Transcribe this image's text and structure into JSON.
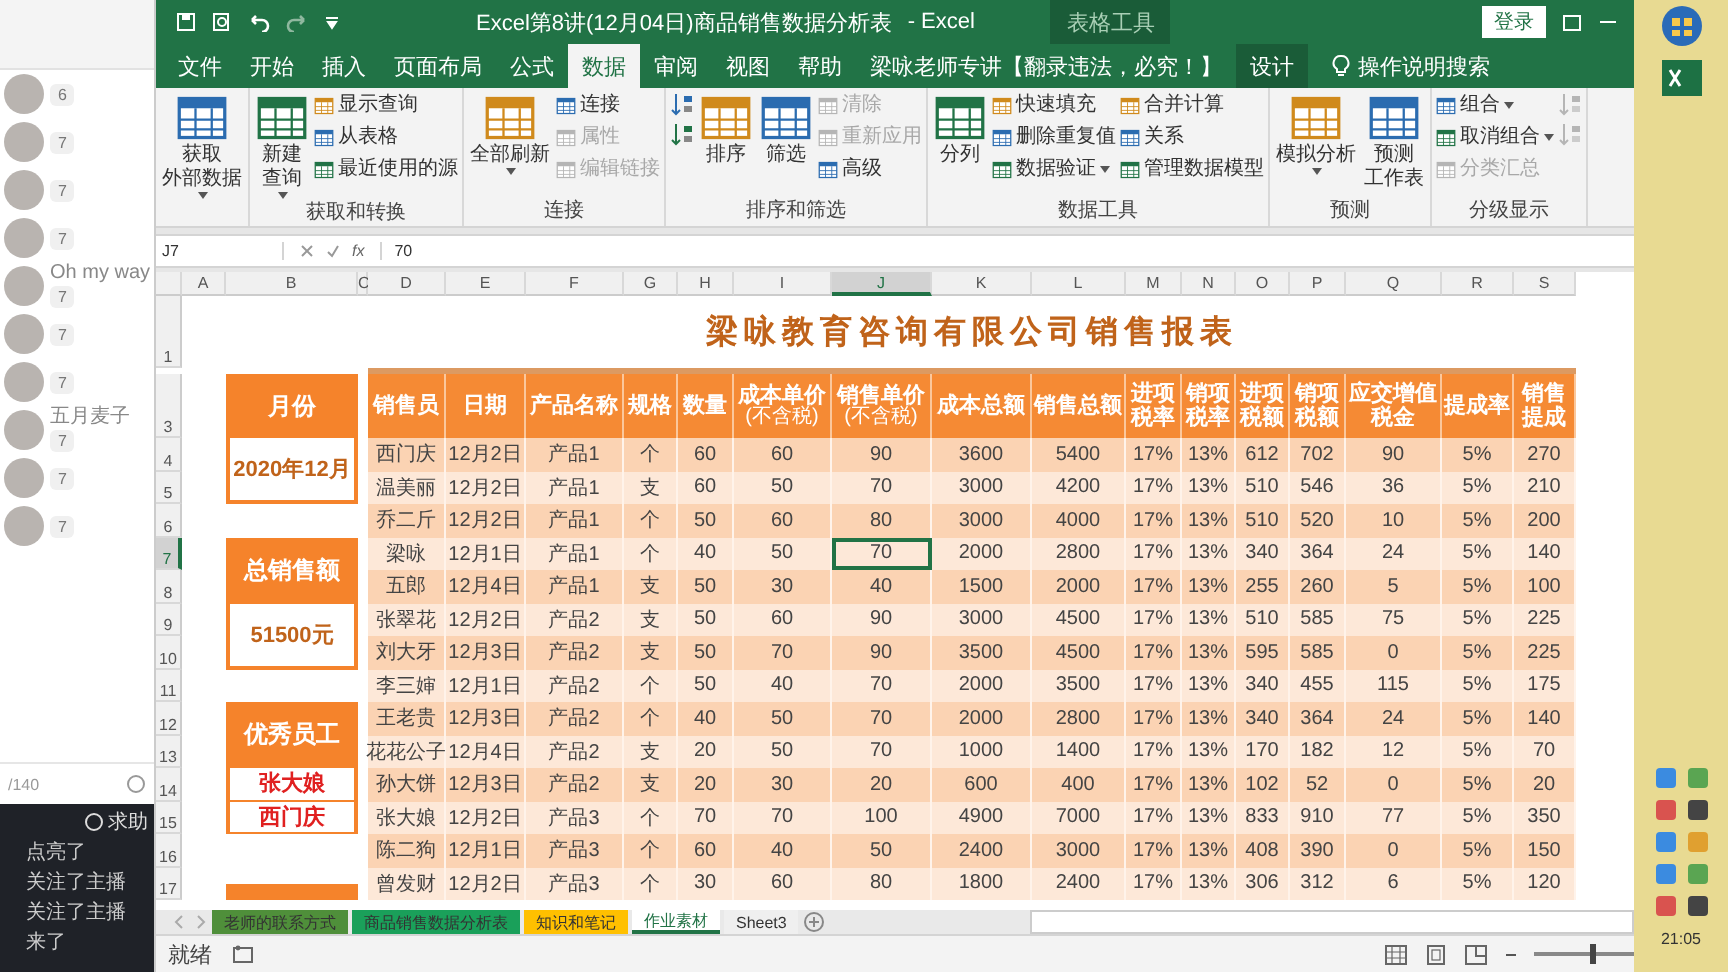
{
  "chat_panel": {
    "members": [
      {
        "count": "6"
      },
      {
        "count": "7"
      },
      {
        "count": "7"
      },
      {
        "count": "7"
      },
      {
        "name": "Oh my way",
        "count": "7"
      },
      {
        "count": "7"
      },
      {
        "count": "7"
      },
      {
        "name": "五月麦子",
        "count": "7"
      },
      {
        "count": "7"
      },
      {
        "count": "7"
      }
    ],
    "char_counter": "/140",
    "help_button": "求助",
    "messages": [
      "点亮了",
      "关注了主播",
      "关注了主播",
      "来了"
    ]
  },
  "window": {
    "title": "Excel第8讲(12月04日)商品销售数据分析表",
    "app": "- Excel",
    "context_label": "表格工具",
    "login": "登录"
  },
  "tabs": [
    {
      "label": "文件",
      "selected": false
    },
    {
      "label": "开始",
      "selected": false
    },
    {
      "label": "插入",
      "selected": false
    },
    {
      "label": "页面布局",
      "selected": false
    },
    {
      "label": "公式",
      "selected": false
    },
    {
      "label": "数据",
      "selected": true
    },
    {
      "label": "审阅",
      "selected": false
    },
    {
      "label": "视图",
      "selected": false
    },
    {
      "label": "帮助",
      "selected": false
    },
    {
      "label": "梁咏老师专讲【翻录违法，必究！】",
      "selected": false
    },
    {
      "label": "设计",
      "selected": false
    }
  ],
  "tell_me": "操作说明搜索",
  "ribbon": [
    {
      "items": [
        {
          "kind": "large",
          "label": [
            "获取",
            "外部数据"
          ],
          "dropdown": true,
          "disabled": false
        }
      ]
    },
    {
      "label": "获取和转换",
      "items": [
        {
          "kind": "large",
          "label": [
            "新建",
            "查询"
          ],
          "dropdown": true,
          "disabled": false
        },
        {
          "kind": "small",
          "label": "显示查询",
          "dropdown": false,
          "disabled": false
        },
        {
          "kind": "small",
          "label": "从表格",
          "dropdown": false,
          "disabled": false
        },
        {
          "kind": "small",
          "label": "最近使用的源",
          "dropdown": false,
          "disabled": false
        }
      ]
    },
    {
      "label": "连接",
      "items": [
        {
          "kind": "large",
          "label": [
            "全部刷新"
          ],
          "dropdown": true,
          "disabled": false
        },
        {
          "kind": "small",
          "label": "连接",
          "dropdown": false,
          "disabled": false
        },
        {
          "kind": "small",
          "label": "属性",
          "dropdown": false,
          "disabled": true
        },
        {
          "kind": "small",
          "label": "编辑链接",
          "dropdown": false,
          "disabled": true
        }
      ]
    },
    {
      "label": "排序和筛选",
      "items": [
        {
          "kind": "icon",
          "disabled": false
        },
        {
          "kind": "icon",
          "disabled": false
        },
        {
          "kind": "large",
          "label": [
            "排序"
          ],
          "dropdown": false,
          "disabled": false
        },
        {
          "kind": "large",
          "label": [
            "筛选"
          ],
          "dropdown": false,
          "disabled": false
        },
        {
          "kind": "small",
          "label": "清除",
          "dropdown": false,
          "disabled": true
        },
        {
          "kind": "small",
          "label": "重新应用",
          "dropdown": false,
          "disabled": true
        },
        {
          "kind": "small",
          "label": "高级",
          "dropdown": false,
          "disabled": false
        }
      ]
    },
    {
      "label": "数据工具",
      "items": [
        {
          "kind": "large",
          "label": [
            "分列"
          ],
          "dropdown": false,
          "disabled": false
        },
        {
          "kind": "small",
          "label": "快速填充",
          "dropdown": false,
          "disabled": false
        },
        {
          "kind": "small",
          "label": "删除重复值",
          "dropdown": false,
          "disabled": false
        },
        {
          "kind": "small",
          "label": "数据验证",
          "dropdown": true,
          "disabled": false
        },
        {
          "kind": "small",
          "label": "合并计算",
          "dropdown": false,
          "disabled": false
        },
        {
          "kind": "small",
          "label": "关系",
          "dropdown": false,
          "disabled": false
        },
        {
          "kind": "small",
          "label": "管理数据模型",
          "dropdown": false,
          "disabled": false
        }
      ]
    },
    {
      "label": "预测",
      "items": [
        {
          "kind": "large",
          "label": [
            "模拟分析"
          ],
          "dropdown": true,
          "disabled": false
        },
        {
          "kind": "large",
          "label": [
            "预测",
            "工作表"
          ],
          "dropdown": false,
          "disabled": false
        }
      ]
    },
    {
      "label": "分级显示",
      "items": [
        {
          "kind": "small",
          "label": "组合",
          "dropdown": true,
          "disabled": false
        },
        {
          "kind": "small",
          "label": "取消组合",
          "dropdown": true,
          "disabled": false
        },
        {
          "kind": "small",
          "label": "分类汇总",
          "dropdown": false,
          "disabled": true
        },
        {
          "kind": "icon",
          "disabled": true
        },
        {
          "kind": "icon",
          "disabled": true
        }
      ]
    }
  ],
  "formula_bar": {
    "name_box": "J7",
    "fx": "fx",
    "value": "70"
  },
  "column_letters": [
    {
      "label": "A",
      "selected": false
    },
    {
      "label": "B",
      "selected": false
    },
    {
      "label": "C",
      "selected": false
    },
    {
      "label": "D",
      "selected": false
    },
    {
      "label": "E",
      "selected": false
    },
    {
      "label": "F",
      "selected": false
    },
    {
      "label": "G",
      "selected": false
    },
    {
      "label": "H",
      "selected": false
    },
    {
      "label": "I",
      "selected": false
    },
    {
      "label": "J",
      "selected": true
    },
    {
      "label": "K",
      "selected": false
    },
    {
      "label": "L",
      "selected": false
    },
    {
      "label": "M",
      "selected": false
    },
    {
      "label": "N",
      "selected": false
    },
    {
      "label": "O",
      "selected": false
    },
    {
      "label": "P",
      "selected": false
    },
    {
      "label": "Q",
      "selected": false
    },
    {
      "label": "R",
      "selected": false
    },
    {
      "label": "S",
      "selected": false
    }
  ],
  "row_numbers": [
    {
      "label": "1",
      "selected": false
    },
    {
      "label": "3",
      "selected": false
    },
    {
      "label": "4",
      "selected": false
    },
    {
      "label": "5",
      "selected": false
    },
    {
      "label": "6",
      "selected": false
    },
    {
      "label": "7",
      "selected": true
    },
    {
      "label": "8",
      "selected": false
    },
    {
      "label": "9",
      "selected": false
    },
    {
      "label": "10",
      "selected": false
    },
    {
      "label": "11",
      "selected": false
    },
    {
      "label": "12",
      "selected": false
    },
    {
      "label": "13",
      "selected": false
    },
    {
      "label": "14",
      "selected": false
    },
    {
      "label": "15",
      "selected": false
    },
    {
      "label": "16",
      "selected": false
    },
    {
      "label": "17",
      "selected": false
    }
  ],
  "summary_boxes": [
    {
      "kind": "period",
      "title": "月份",
      "values": [
        "2020年12月"
      ]
    },
    {
      "kind": "total",
      "title": "总销售额",
      "values": [
        "51500元"
      ]
    },
    {
      "kind": "staff",
      "title": "优秀员工",
      "values": [
        "张大娘",
        "西门庆"
      ]
    }
  ],
  "report": {
    "title": "梁咏教育咨询有限公司销售报表",
    "columns": [
      {
        "label": "销售员"
      },
      {
        "label": "日期"
      },
      {
        "label": "产品名称"
      },
      {
        "label": "规格"
      },
      {
        "label": "数量"
      },
      {
        "label": "成本单价",
        "note": "(不含税)"
      },
      {
        "label": "销售单价",
        "note": "(不含税)"
      },
      {
        "label": "成本总额"
      },
      {
        "label": "销售总额"
      },
      {
        "label": "进项税率"
      },
      {
        "label": "销项税率"
      },
      {
        "label": "进项税额"
      },
      {
        "label": "销项税额"
      },
      {
        "label": "应交增值税金"
      },
      {
        "label": "提成率"
      },
      {
        "label": "销售提成"
      }
    ],
    "rows": [
      [
        "西门庆",
        "12月2日",
        "产品1",
        "个",
        "60",
        "60",
        "90",
        "3600",
        "5400",
        "17%",
        "13%",
        "612",
        "702",
        "90",
        "5%",
        "270"
      ],
      [
        "温美丽",
        "12月2日",
        "产品1",
        "支",
        "60",
        "50",
        "70",
        "3000",
        "4200",
        "17%",
        "13%",
        "510",
        "546",
        "36",
        "5%",
        "210"
      ],
      [
        "乔二斤",
        "12月2日",
        "产品1",
        "个",
        "50",
        "60",
        "80",
        "3000",
        "4000",
        "17%",
        "13%",
        "510",
        "520",
        "10",
        "5%",
        "200"
      ],
      [
        "梁咏",
        "12月1日",
        "产品1",
        "个",
        "40",
        "50",
        "70",
        "2000",
        "2800",
        "17%",
        "13%",
        "340",
        "364",
        "24",
        "5%",
        "140"
      ],
      [
        "五郎",
        "12月4日",
        "产品1",
        "支",
        "50",
        "30",
        "40",
        "1500",
        "2000",
        "17%",
        "13%",
        "255",
        "260",
        "5",
        "5%",
        "100"
      ],
      [
        "张翠花",
        "12月2日",
        "产品2",
        "支",
        "50",
        "60",
        "90",
        "3000",
        "4500",
        "17%",
        "13%",
        "510",
        "585",
        "75",
        "5%",
        "225"
      ],
      [
        "刘大牙",
        "12月3日",
        "产品2",
        "支",
        "50",
        "70",
        "90",
        "3500",
        "4500",
        "17%",
        "13%",
        "595",
        "585",
        "0",
        "5%",
        "225"
      ],
      [
        "李三婶",
        "12月1日",
        "产品2",
        "个",
        "50",
        "40",
        "70",
        "2000",
        "3500",
        "17%",
        "13%",
        "340",
        "455",
        "115",
        "5%",
        "175"
      ],
      [
        "王老贵",
        "12月3日",
        "产品2",
        "个",
        "40",
        "50",
        "70",
        "2000",
        "2800",
        "17%",
        "13%",
        "340",
        "364",
        "24",
        "5%",
        "140"
      ],
      [
        "花花公子",
        "12月4日",
        "产品2",
        "支",
        "20",
        "50",
        "70",
        "1000",
        "1400",
        "17%",
        "13%",
        "170",
        "182",
        "12",
        "5%",
        "70"
      ],
      [
        "孙大饼",
        "12月3日",
        "产品2",
        "支",
        "20",
        "30",
        "20",
        "600",
        "400",
        "17%",
        "13%",
        "102",
        "52",
        "0",
        "5%",
        "20"
      ],
      [
        "张大娘",
        "12月2日",
        "产品3",
        "个",
        "70",
        "70",
        "100",
        "4900",
        "7000",
        "17%",
        "13%",
        "833",
        "910",
        "77",
        "5%",
        "350"
      ],
      [
        "陈二狗",
        "12月1日",
        "产品3",
        "个",
        "60",
        "40",
        "50",
        "2400",
        "3000",
        "17%",
        "13%",
        "408",
        "390",
        "0",
        "5%",
        "150"
      ],
      [
        "曾发财",
        "12月2日",
        "产品3",
        "个",
        "30",
        "60",
        "80",
        "1800",
        "2400",
        "17%",
        "13%",
        "306",
        "312",
        "6",
        "5%",
        "120"
      ]
    ]
  },
  "sheet_tabs": [
    {
      "label": "老师的联系方式",
      "color": "#4f8f3a",
      "selected": false
    },
    {
      "label": "商品销售数据分析表",
      "color": "#1aa05a",
      "selected": false
    },
    {
      "label": "知识和笔记",
      "color": "#ffc000",
      "selected": false
    },
    {
      "label": "作业素材",
      "selected": true
    },
    {
      "label": "Sheet3",
      "selected": false
    }
  ],
  "status_bar": {
    "text": "就绪",
    "zoom": {
      "level": 0.55
    }
  },
  "clock": "21:05"
}
